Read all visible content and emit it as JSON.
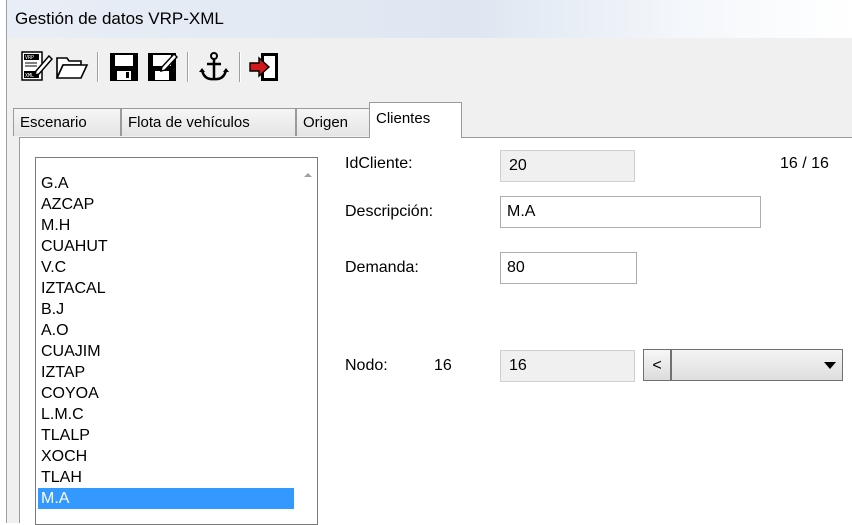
{
  "window": {
    "title": "Gestión de datos VRP-XML"
  },
  "toolbar": {
    "icons": [
      "xml-edit-icon",
      "folder-open-icon",
      "save-icon",
      "save-as-icon",
      "anchor-icon",
      "exit-icon"
    ]
  },
  "tabs": [
    {
      "label": "Escenario"
    },
    {
      "label": "Flota de vehículos"
    },
    {
      "label": "Origen"
    },
    {
      "label": "Clientes",
      "active": true
    }
  ],
  "clients": {
    "items": [
      "G.A",
      "AZCAP",
      "M.H",
      "CUAHUT",
      "V.C",
      "IZTACAL",
      "B.J",
      "A.O",
      "CUAJIM",
      "IZTAP",
      "COYOA",
      "L.M.C",
      "TLALP",
      "XOCH",
      "TLAH",
      "M.A"
    ],
    "selected_index": 15
  },
  "form": {
    "id_label": "IdCliente:",
    "id_value": "20",
    "counter": "16 / 16",
    "desc_label": "Descripción:",
    "desc_value": "M.A",
    "demand_label": "Demanda:",
    "demand_value": "80",
    "node_label": "Nodo:",
    "node_number": "16",
    "node_value": "16",
    "prev_label": "<",
    "node_combo_value": ""
  }
}
